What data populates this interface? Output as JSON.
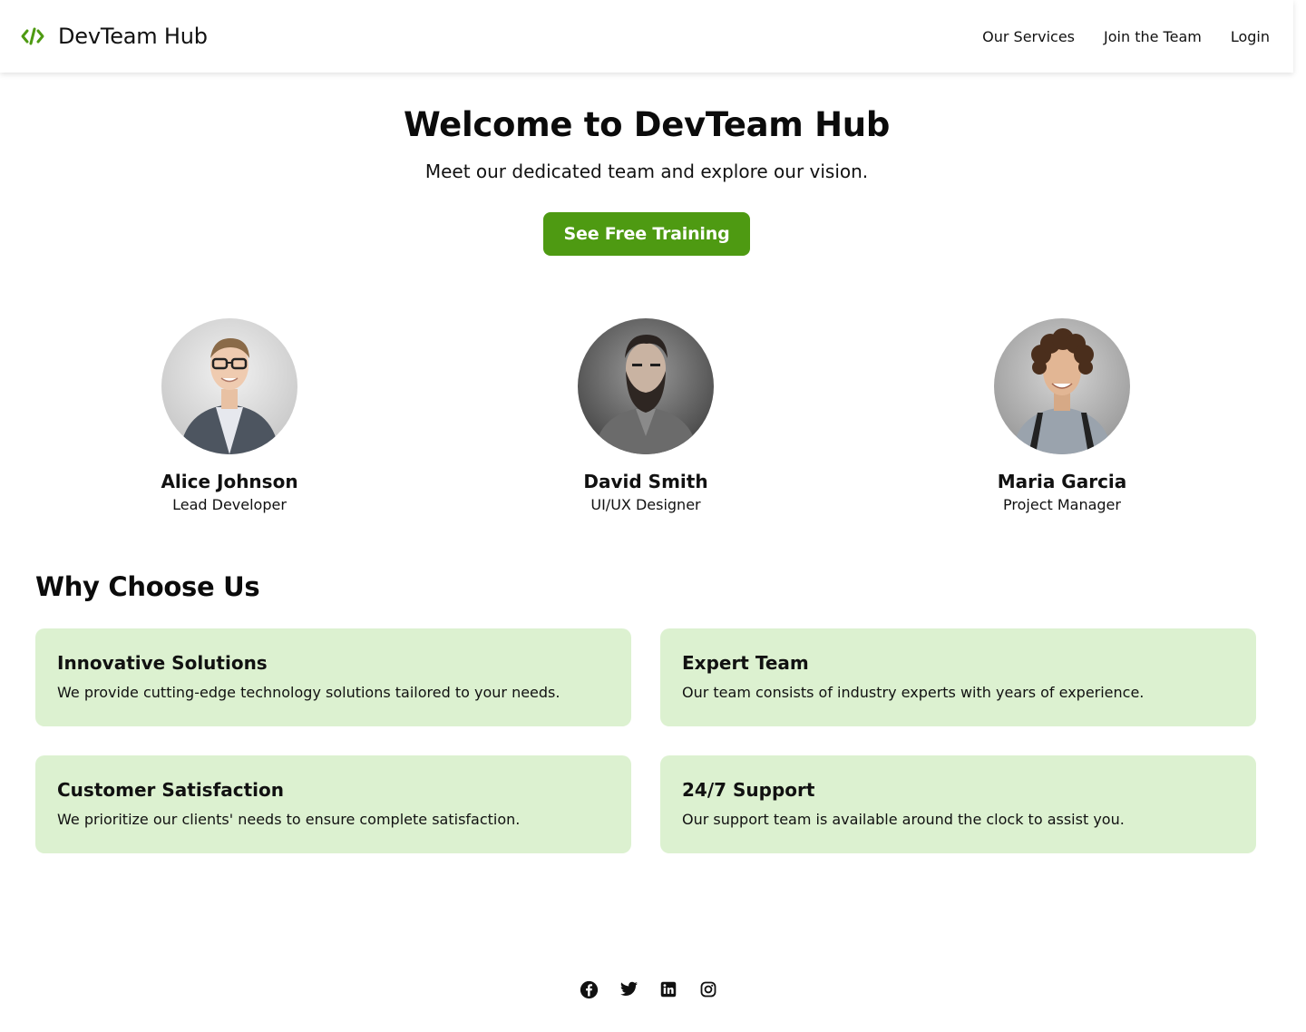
{
  "header": {
    "brand": "DevTeam Hub",
    "brand_icon": "code-brackets-icon",
    "nav": [
      "Our Services",
      "Join the Team",
      "Login"
    ]
  },
  "hero": {
    "title": "Welcome to DevTeam Hub",
    "subtitle": "Meet our dedicated team and explore our vision.",
    "cta": "See Free Training"
  },
  "team": [
    {
      "name": "Alice Johnson",
      "role": "Lead Developer"
    },
    {
      "name": "David Smith",
      "role": "UI/UX Designer"
    },
    {
      "name": "Maria Garcia",
      "role": "Project Manager"
    }
  ],
  "why": {
    "title": "Why Choose Us",
    "cards": [
      {
        "title": "Innovative Solutions",
        "text": "We provide cutting-edge technology solutions tailored to your needs."
      },
      {
        "title": "Expert Team",
        "text": "Our team consists of industry experts with years of experience."
      },
      {
        "title": "Customer Satisfaction",
        "text": "We prioritize our clients' needs to ensure complete satisfaction."
      },
      {
        "title": "24/7 Support",
        "text": "Our support team is available around the clock to assist you."
      }
    ]
  },
  "footer": {
    "social_icons": [
      "facebook-icon",
      "twitter-icon",
      "linkedin-icon",
      "instagram-icon"
    ]
  },
  "colors": {
    "accent": "#4e9a12",
    "card_bg": "#dcf1d0",
    "text": "#111111"
  }
}
